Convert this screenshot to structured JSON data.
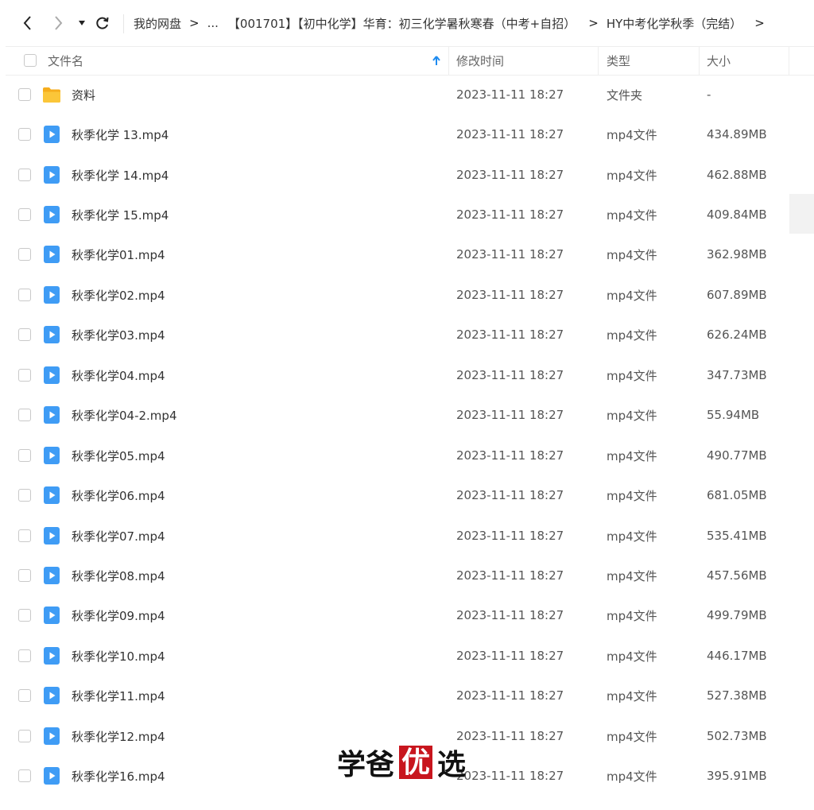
{
  "toolbar": {
    "back_icon": "chevron-left-icon",
    "forward_icon": "chevron-right-icon",
    "history_icon": "caret-down-icon",
    "refresh_icon": "refresh-icon"
  },
  "breadcrumb": {
    "items": [
      "我的网盘",
      "...",
      "【001701】【初中化学】华育：初三化学暑秋寒春（中考+自招）",
      "HY中考化学秋季（完结）"
    ],
    "separator": ">"
  },
  "table": {
    "columns": {
      "name": "文件名",
      "modified": "修改时间",
      "type": "类型",
      "size": "大小"
    },
    "sort_icon": "sort-ascending-arrow-icon",
    "rows": [
      {
        "name": "资料",
        "modified": "2023-11-11 18:27",
        "type": "文件夹",
        "size": "-",
        "icon": "folder-icon"
      },
      {
        "name": "秋季化学 13.mp4",
        "modified": "2023-11-11 18:27",
        "type": "mp4文件",
        "size": "434.89MB",
        "icon": "video-file-icon"
      },
      {
        "name": "秋季化学 14.mp4",
        "modified": "2023-11-11 18:27",
        "type": "mp4文件",
        "size": "462.88MB",
        "icon": "video-file-icon"
      },
      {
        "name": "秋季化学 15.mp4",
        "modified": "2023-11-11 18:27",
        "type": "mp4文件",
        "size": "409.84MB",
        "icon": "video-file-icon"
      },
      {
        "name": "秋季化学01.mp4",
        "modified": "2023-11-11 18:27",
        "type": "mp4文件",
        "size": "362.98MB",
        "icon": "video-file-icon"
      },
      {
        "name": "秋季化学02.mp4",
        "modified": "2023-11-11 18:27",
        "type": "mp4文件",
        "size": "607.89MB",
        "icon": "video-file-icon"
      },
      {
        "name": "秋季化学03.mp4",
        "modified": "2023-11-11 18:27",
        "type": "mp4文件",
        "size": "626.24MB",
        "icon": "video-file-icon"
      },
      {
        "name": "秋季化学04.mp4",
        "modified": "2023-11-11 18:27",
        "type": "mp4文件",
        "size": "347.73MB",
        "icon": "video-file-icon"
      },
      {
        "name": "秋季化学04-2.mp4",
        "modified": "2023-11-11 18:27",
        "type": "mp4文件",
        "size": "55.94MB",
        "icon": "video-file-icon"
      },
      {
        "name": "秋季化学05.mp4",
        "modified": "2023-11-11 18:27",
        "type": "mp4文件",
        "size": "490.77MB",
        "icon": "video-file-icon"
      },
      {
        "name": "秋季化学06.mp4",
        "modified": "2023-11-11 18:27",
        "type": "mp4文件",
        "size": "681.05MB",
        "icon": "video-file-icon"
      },
      {
        "name": "秋季化学07.mp4",
        "modified": "2023-11-11 18:27",
        "type": "mp4文件",
        "size": "535.41MB",
        "icon": "video-file-icon"
      },
      {
        "name": "秋季化学08.mp4",
        "modified": "2023-11-11 18:27",
        "type": "mp4文件",
        "size": "457.56MB",
        "icon": "video-file-icon"
      },
      {
        "name": "秋季化学09.mp4",
        "modified": "2023-11-11 18:27",
        "type": "mp4文件",
        "size": "499.79MB",
        "icon": "video-file-icon"
      },
      {
        "name": "秋季化学10.mp4",
        "modified": "2023-11-11 18:27",
        "type": "mp4文件",
        "size": "446.17MB",
        "icon": "video-file-icon"
      },
      {
        "name": "秋季化学11.mp4",
        "modified": "2023-11-11 18:27",
        "type": "mp4文件",
        "size": "527.38MB",
        "icon": "video-file-icon"
      },
      {
        "name": "秋季化学12.mp4",
        "modified": "2023-11-11 18:27",
        "type": "mp4文件",
        "size": "502.73MB",
        "icon": "video-file-icon"
      },
      {
        "name": "秋季化学16.mp4",
        "modified": "2023-11-11 18:27",
        "type": "mp4文件",
        "size": "395.91MB",
        "icon": "video-file-icon"
      }
    ]
  },
  "watermark": {
    "text1": "学爸",
    "text2": "优",
    "text3": "选"
  },
  "colors": {
    "accent": "#1e8bf0",
    "video_icon": "#3f9cf5",
    "folder": "#f9bd2a",
    "seal": "#c8161e"
  }
}
